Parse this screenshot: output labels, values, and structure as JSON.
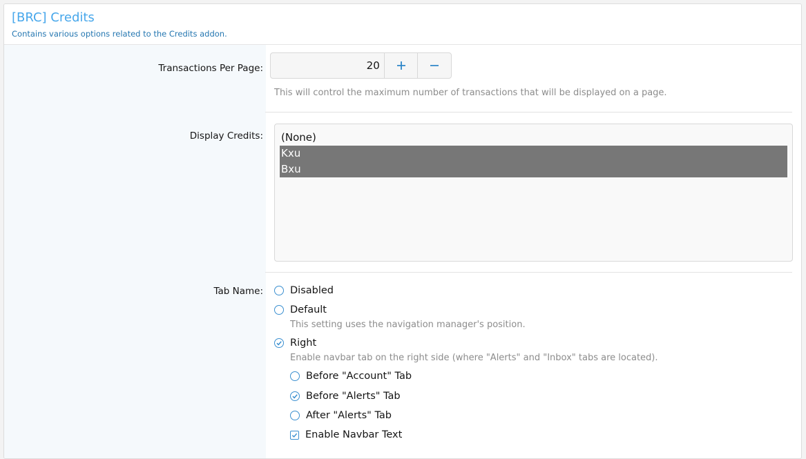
{
  "header": {
    "title": "[BRC] Credits",
    "description": "Contains various options related to the Credits addon."
  },
  "transactions": {
    "label": "Transactions Per Page:",
    "value": "20",
    "plus": "+",
    "minus": "−",
    "explain": "This will control the maximum number of transactions that will be displayed on a page."
  },
  "display_credits": {
    "label": "Display Credits:",
    "options": [
      {
        "label": "(None)",
        "selected": false
      },
      {
        "label": "Kxu",
        "selected": true
      },
      {
        "label": "Bxu",
        "selected": true
      }
    ]
  },
  "tab_name": {
    "label": "Tab Name:",
    "options": {
      "disabled": {
        "label": "Disabled",
        "checked": false
      },
      "default": {
        "label": "Default",
        "checked": false,
        "hint": "This setting uses the navigation manager's position."
      },
      "right": {
        "label": "Right",
        "checked": true,
        "hint": "Enable navbar tab on the right side (where \"Alerts\" and \"Inbox\" tabs are located)."
      }
    },
    "sub_options": {
      "before_account": {
        "label": "Before \"Account\" Tab",
        "checked": false
      },
      "before_alerts": {
        "label": "Before \"Alerts\" Tab",
        "checked": true
      },
      "after_alerts": {
        "label": "After \"Alerts\" Tab",
        "checked": false
      },
      "navbar_text": {
        "label": "Enable Navbar Text",
        "checked": true
      }
    }
  },
  "colors": {
    "accent": "#47a7eb",
    "link": "#2577b1",
    "selected_bg": "#777777",
    "label_col_bg": "#f5f9fc"
  }
}
